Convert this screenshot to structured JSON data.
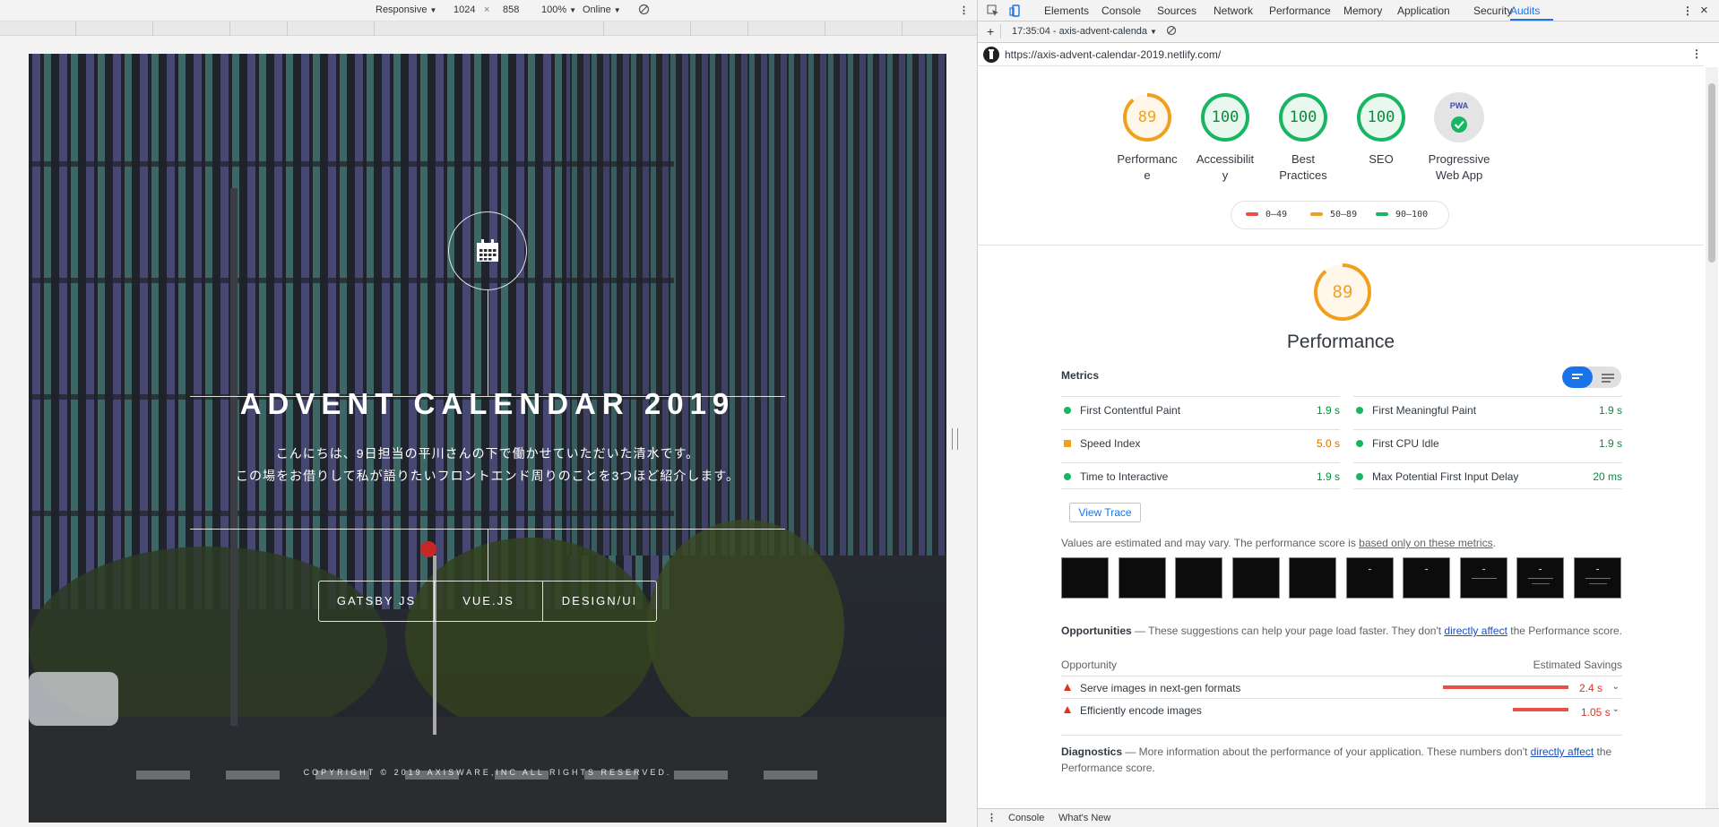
{
  "device_toolbar": {
    "device": "Responsive",
    "width": "1024",
    "times": "×",
    "height": "858",
    "zoom": "100%",
    "network": "Online"
  },
  "hero": {
    "title": "ADVENT CALENDAR 2019",
    "line1": "こんにちは、9日担当の平川さんの下で働かせていただいた清水です。",
    "line2": "この場をお借りして私が語りたいフロントエンド周りのことを3つほど紹介します。",
    "tags": [
      "GATSBY JS",
      "VUE.JS",
      "DESIGN/UI"
    ],
    "copyright": "COPYRIGHT © 2019 AXISWARE,INC ALL RIGHTS RESERVED."
  },
  "devtools": {
    "tabs": [
      "Elements",
      "Console",
      "Sources",
      "Network",
      "Performance",
      "Memory",
      "Application",
      "Security",
      "Audits"
    ],
    "active_tab": "Audits",
    "report_selector": "17:35:04 - axis-advent-calenda",
    "url": "https://axis-advent-calendar-2019.netlify.com/",
    "drawer_tabs": [
      "Console",
      "What's New"
    ]
  },
  "gauges": [
    {
      "score": "89",
      "label_l1": "Performanc",
      "label_l2": "e",
      "level": "average"
    },
    {
      "score": "100",
      "label_l1": "Accessibilit",
      "label_l2": "y",
      "level": "pass"
    },
    {
      "score": "100",
      "label_l1": "Best",
      "label_l2": "Practices",
      "level": "pass"
    },
    {
      "score": "100",
      "label_l1": "SEO",
      "label_l2": "",
      "level": "pass"
    },
    {
      "pwa_badge": "PWA",
      "label_l1": "Progressive",
      "label_l2": "Web App",
      "level": "pwa"
    }
  ],
  "legend": {
    "fail": "0–49",
    "average": "50–89",
    "pass": "90–100"
  },
  "performance": {
    "score": "89",
    "title": "Performance",
    "metrics_heading": "Metrics",
    "metrics": [
      {
        "name": "First Contentful Paint",
        "value": "1.9 s",
        "level": "pass"
      },
      {
        "name": "First Meaningful Paint",
        "value": "1.9 s",
        "level": "pass"
      },
      {
        "name": "Speed Index",
        "value": "5.0 s",
        "level": "average"
      },
      {
        "name": "First CPU Idle",
        "value": "1.9 s",
        "level": "pass"
      },
      {
        "name": "Time to Interactive",
        "value": "1.9 s",
        "level": "pass"
      },
      {
        "name": "Max Potential First Input Delay",
        "value": "20 ms",
        "level": "pass"
      }
    ],
    "view_trace": "View Trace",
    "note_prefix": "Values are estimated and may vary. The performance score is ",
    "note_link": "based only on these metrics",
    "note_suffix": "."
  },
  "opportunities": {
    "heading": "Opportunities",
    "text_pre": " — These suggestions can help your page load faster. They don't ",
    "text_link": "directly affect",
    "text_post": " the Performance score.",
    "col_opportunity": "Opportunity",
    "col_savings": "Estimated Savings",
    "items": [
      {
        "name": "Serve images in next-gen formats",
        "savings": "2.4 s",
        "fraction": 1.0
      },
      {
        "name": "Efficiently encode images",
        "savings": "1.05 s",
        "fraction": 0.44
      }
    ]
  },
  "diagnostics": {
    "heading": "Diagnostics",
    "text_pre": " — More information about the performance of your application. These numbers don't ",
    "text_link": "directly affect",
    "text_post": " the Performance score."
  },
  "colors": {
    "pass": "#18b663",
    "average": "#f0a020",
    "fail": "#e0331f",
    "accent": "#1a73e8"
  }
}
